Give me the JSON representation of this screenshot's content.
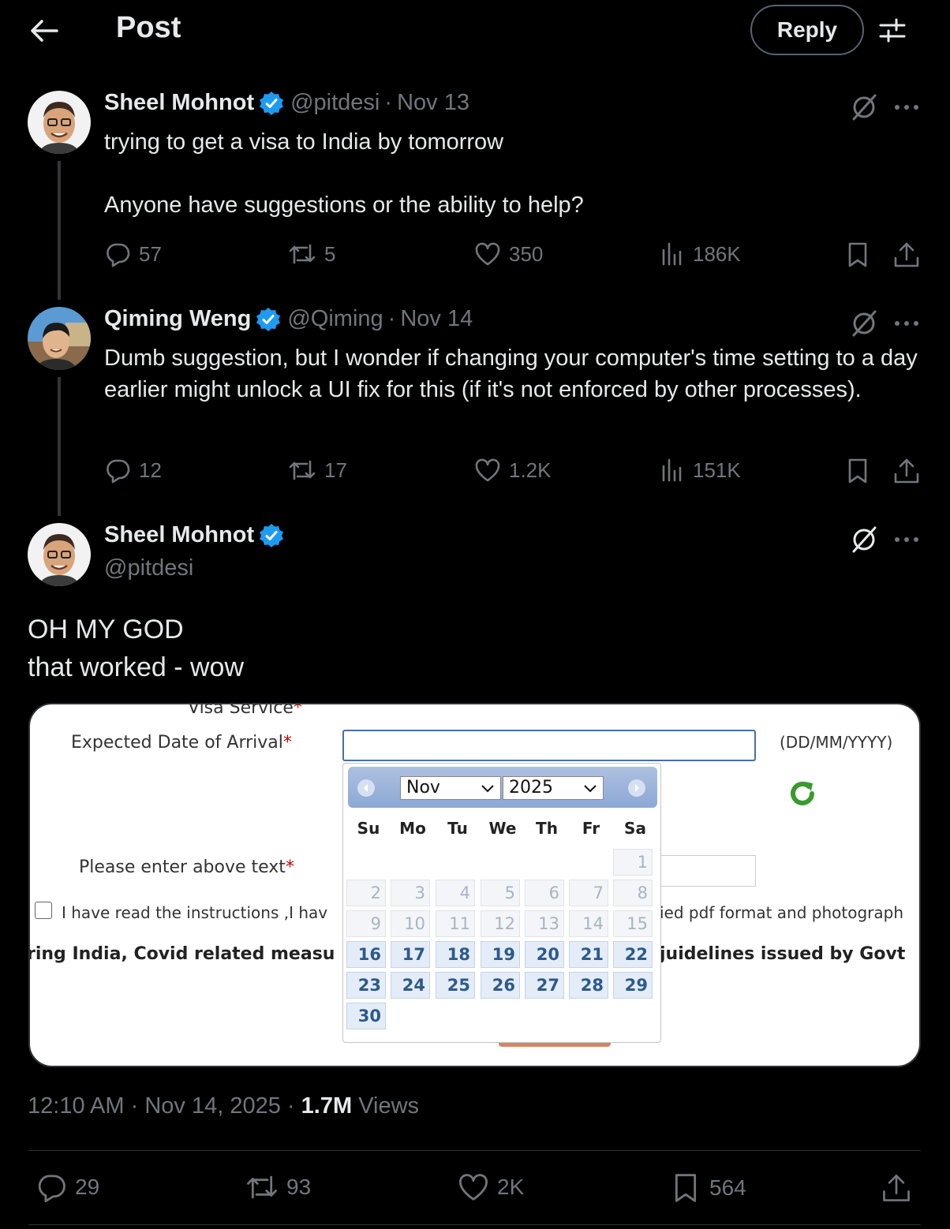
{
  "header": {
    "title": "Post",
    "reply_label": "Reply"
  },
  "tweets": [
    {
      "name": "Sheel Mohnot",
      "handle": "@pitdesi",
      "date": "Nov 13",
      "sep": "·",
      "text1": "trying to get a visa to India by tomorrow",
      "text2": "Anyone have suggestions or the ability to help?",
      "replies": "57",
      "reposts": "5",
      "likes": "350",
      "views": "186K"
    },
    {
      "name": "Qiming Weng",
      "handle": "@Qiming",
      "date": "Nov 14",
      "sep": "·",
      "text1": "Dumb suggestion, but I wonder if changing your computer's time setting to a day earlier might unlock a UI fix for this (if it's not enforced by other processes).",
      "replies": "12",
      "reposts": "17",
      "likes": "1.2K",
      "views": "151K"
    }
  ],
  "main": {
    "name": "Sheel Mohnot",
    "handle": "@pitdesi",
    "line1": "OH MY GOD",
    "line2": "that worked - wow",
    "time": "12:10 AM",
    "sep": "·",
    "date": "Nov 14, 2025",
    "views_count": "1.7M",
    "views_label": "Views",
    "replies": "29",
    "reposts": "93",
    "likes": "2K",
    "bookmarks": "564"
  },
  "image": {
    "visa_service": "Visa Service",
    "arrival_label": "Expected Date of Arrival",
    "asterisk": "*",
    "format": "(DD/MM/YYYY)",
    "captcha_label": "Please enter above text",
    "checkbox_text_left": "I have read the instructions ,I hav",
    "checkbox_text_right": "ied pdf format and photograph",
    "covid_left": "ring India, Covid related measu",
    "covid_right": "juidelines issued by Govt",
    "calendar": {
      "month": "Nov",
      "year": "2025",
      "weekdays": [
        "Su",
        "Mo",
        "Tu",
        "We",
        "Th",
        "Fr",
        "Sa"
      ],
      "days": [
        "1",
        "2",
        "3",
        "4",
        "5",
        "6",
        "7",
        "8",
        "9",
        "10",
        "11",
        "12",
        "13",
        "14",
        "15",
        "16",
        "17",
        "18",
        "19",
        "20",
        "21",
        "22",
        "23",
        "24",
        "25",
        "26",
        "27",
        "28",
        "29",
        "30"
      ],
      "first_enabled_day": 16
    },
    "accent": "#3a9a2e"
  },
  "colors": {
    "verified": "#1d9bf0",
    "muted": "#71767b",
    "text": "#e7e9ea"
  }
}
